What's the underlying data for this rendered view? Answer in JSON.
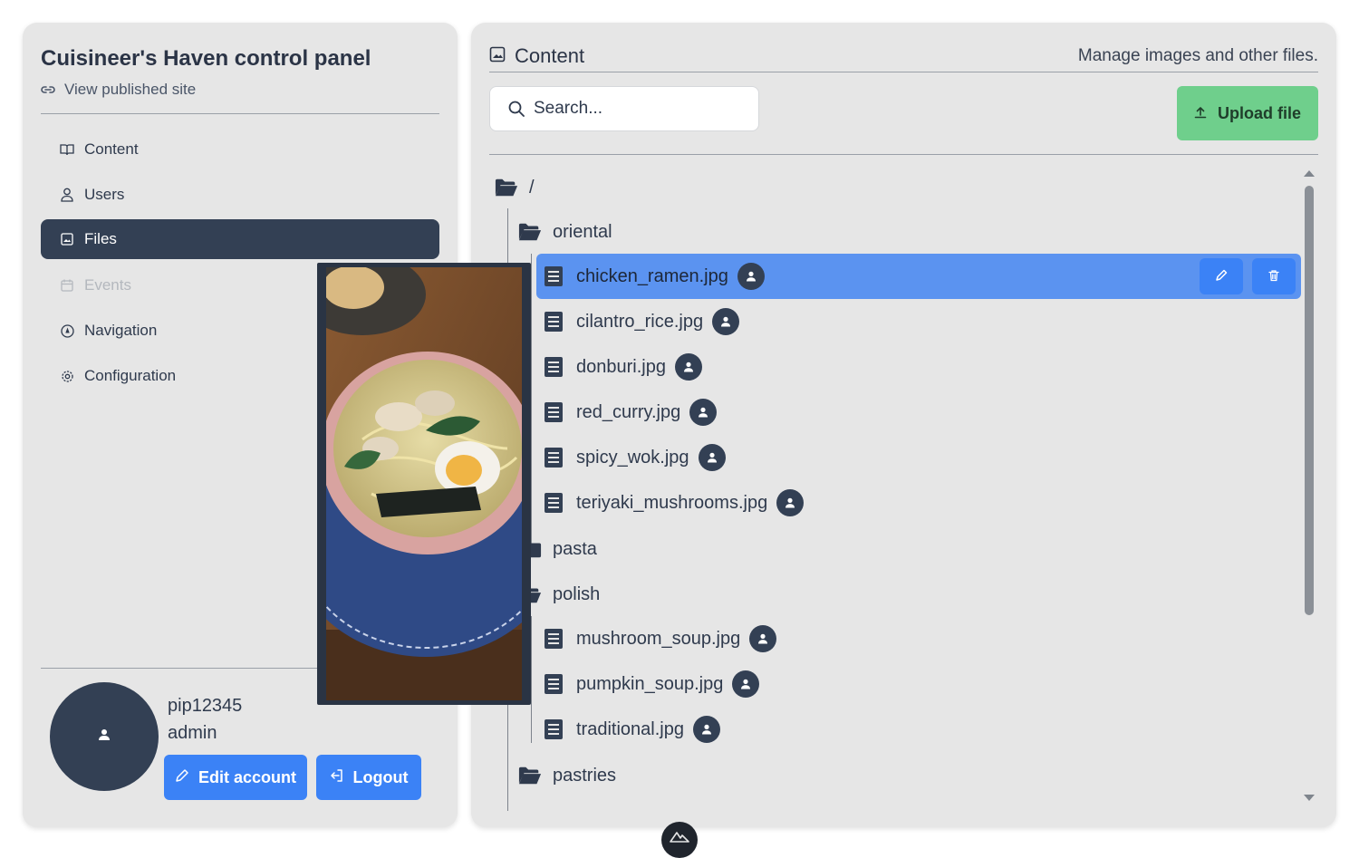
{
  "sidebar": {
    "title": "Cuisineer's Haven control panel",
    "published_link": "View published site",
    "nav": [
      {
        "label": "Content",
        "icon": "book-icon",
        "state": "normal"
      },
      {
        "label": "Users",
        "icon": "user-icon",
        "state": "normal"
      },
      {
        "label": "Files",
        "icon": "image-icon",
        "state": "active"
      },
      {
        "label": "Events",
        "icon": "calendar-icon",
        "state": "disabled"
      },
      {
        "label": "Navigation",
        "icon": "compass-icon",
        "state": "normal"
      },
      {
        "label": "Configuration",
        "icon": "gear-icon",
        "state": "normal"
      }
    ],
    "user": {
      "name": "pip12345",
      "role": "admin"
    },
    "edit_account": "Edit account",
    "logout": "Logout"
  },
  "main": {
    "title": "Content",
    "subtitle": "Manage images and other files.",
    "search_placeholder": "Search...",
    "upload": "Upload file",
    "root": "/",
    "folders": {
      "oriental": "oriental",
      "pasta": "pasta",
      "polish": "polish",
      "pastries": "pastries"
    },
    "oriental_files": [
      "chicken_ramen.jpg",
      "cilantro_rice.jpg",
      "donburi.jpg",
      "red_curry.jpg",
      "spicy_wok.jpg",
      "teriyaki_mushrooms.jpg"
    ],
    "polish_files": [
      "mushroom_soup.jpg",
      "pumpkin_soup.jpg",
      "traditional.jpg"
    ],
    "selected_file": "chicken_ramen.jpg"
  },
  "colors": {
    "accent": "#3b82f6",
    "selected": "#5b93f0",
    "dark": "#334054",
    "upload": "#6fcf8c",
    "panel": "#e6e6e6"
  }
}
